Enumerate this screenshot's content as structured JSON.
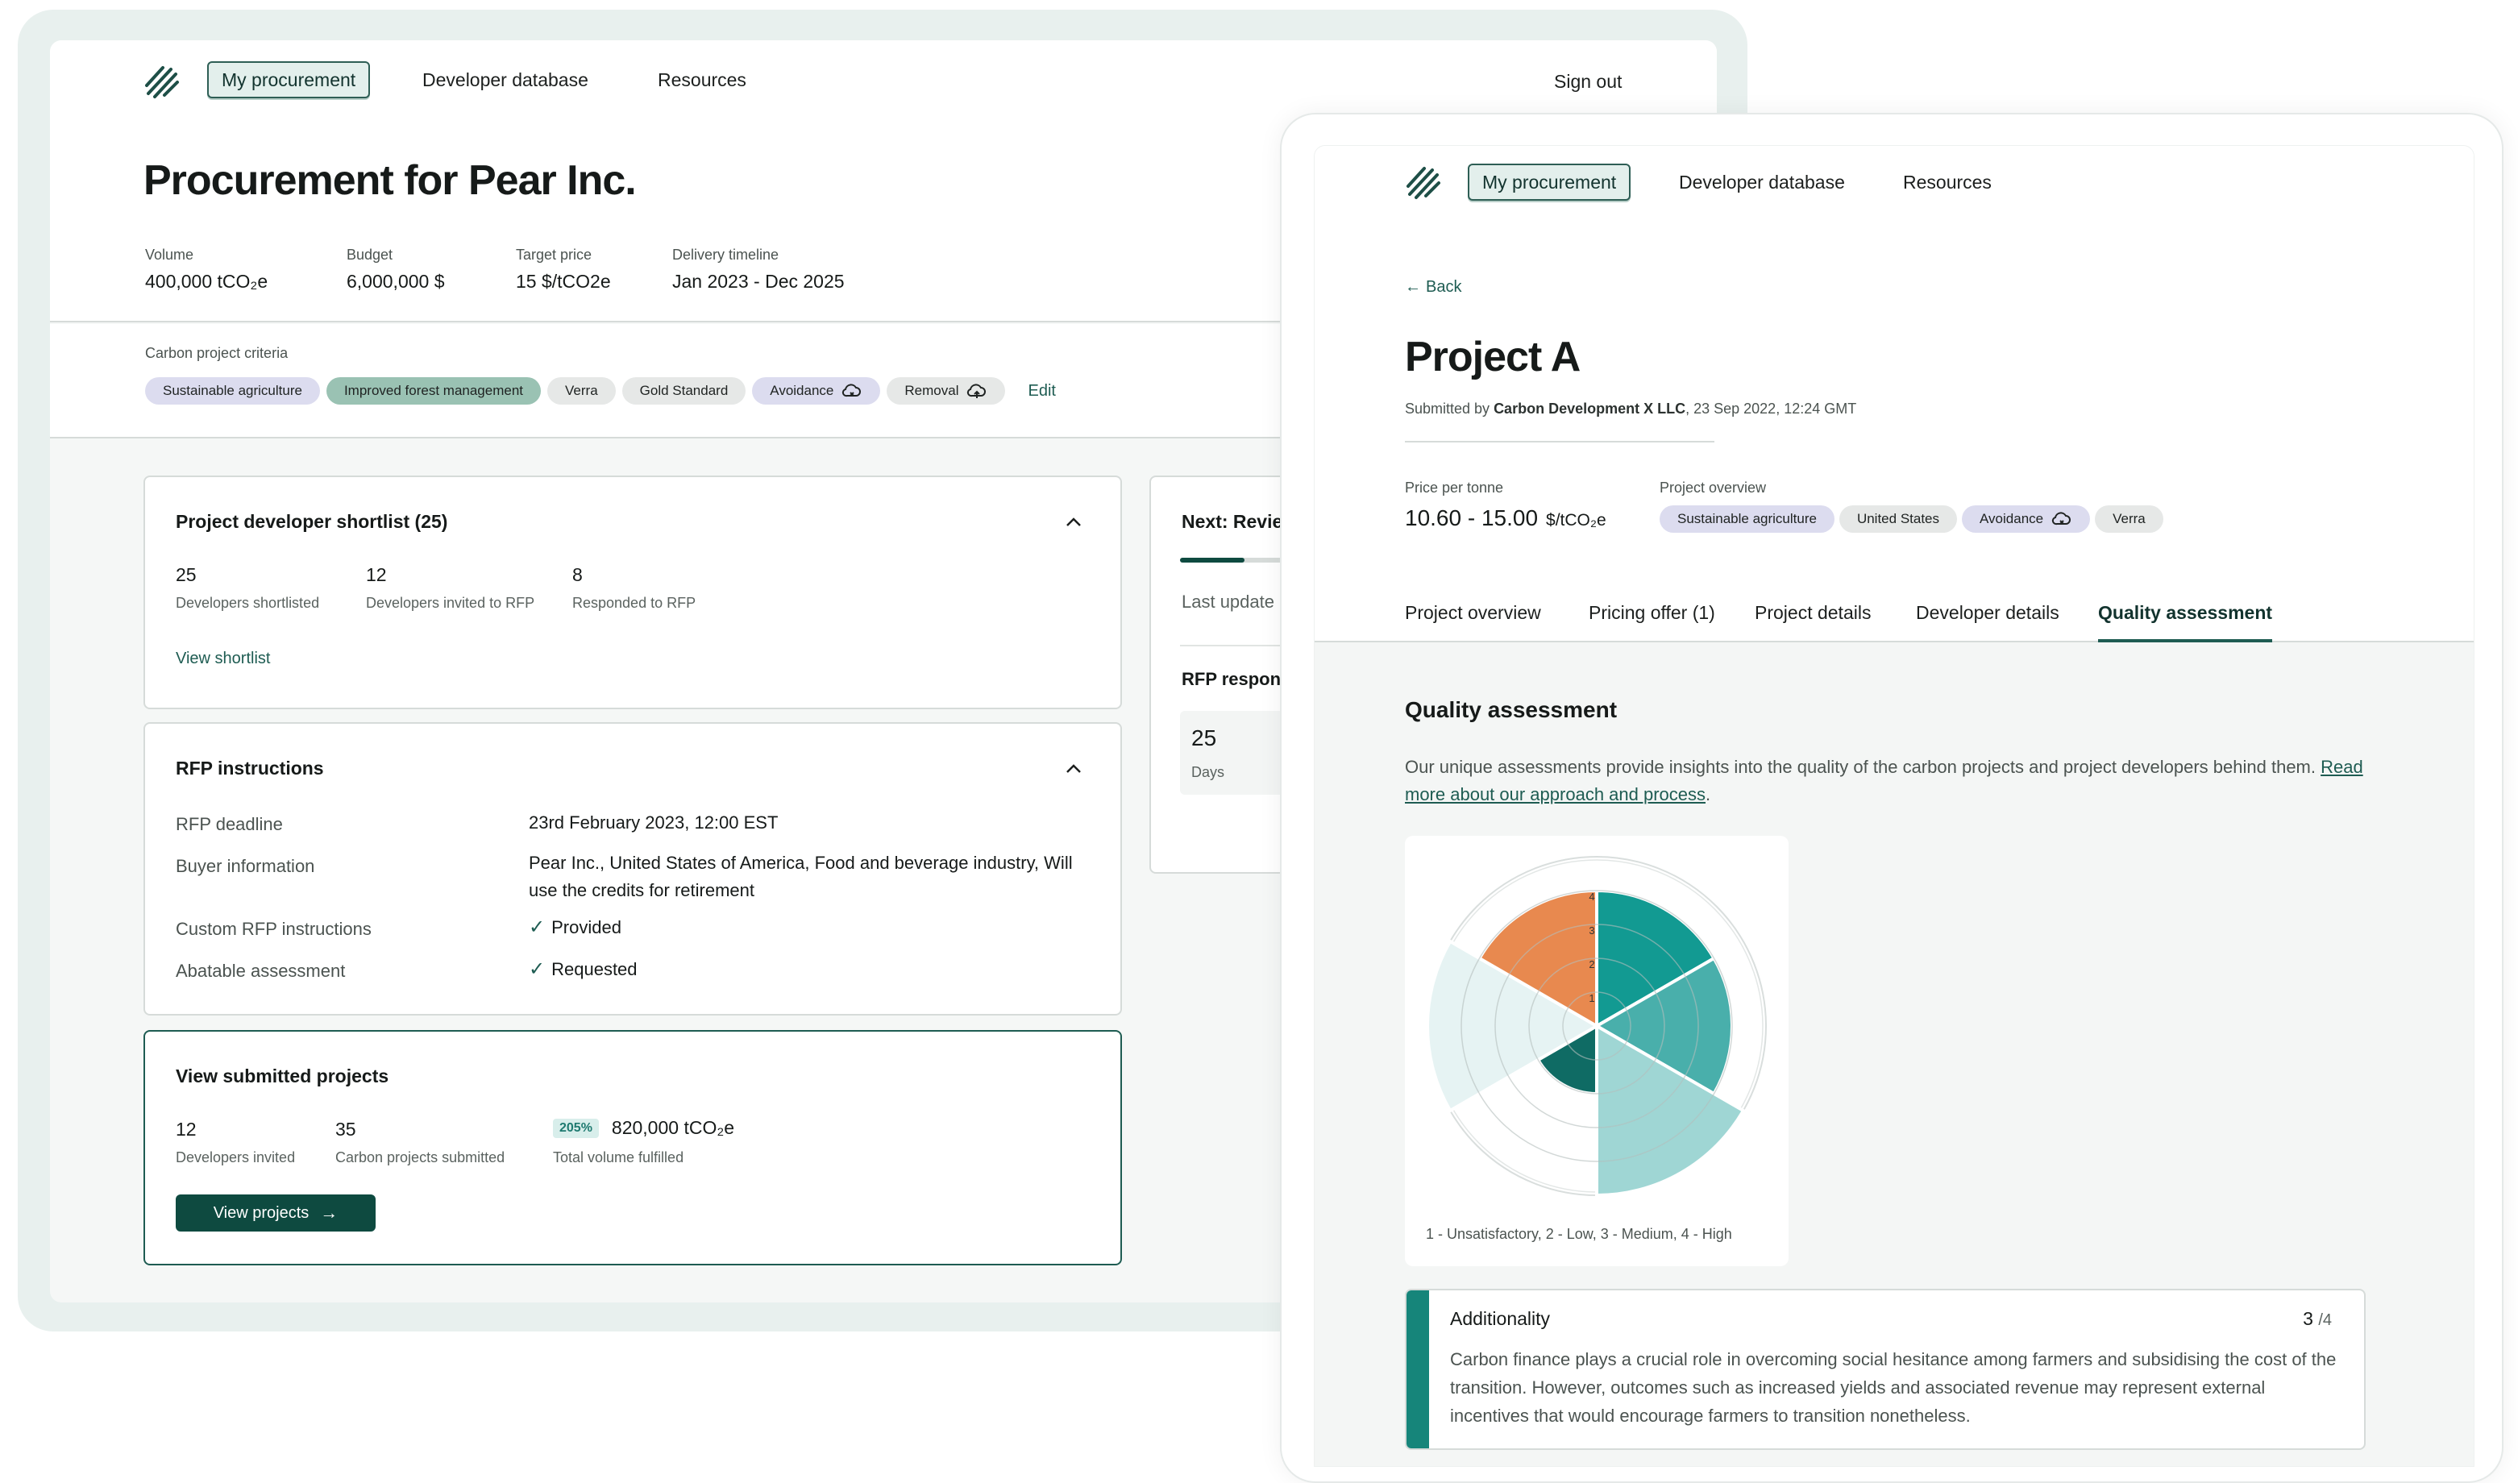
{
  "back": {
    "nav": {
      "active": "My procurement",
      "items": [
        "Developer database",
        "Resources"
      ],
      "sign_out": "Sign out"
    },
    "title": "Procurement for Pear Inc.",
    "meta": [
      {
        "label": "Volume",
        "value": "400,000 tCO₂e"
      },
      {
        "label": "Budget",
        "value": "6,000,000 $"
      },
      {
        "label": "Target price",
        "value": "15 $/tCO2e"
      },
      {
        "label": "Delivery timeline",
        "value": "Jan 2023 - Dec 2025"
      }
    ],
    "criteria": {
      "label": "Carbon project criteria",
      "chips": [
        "Sustainable agriculture",
        "Improved forest management",
        "Verra",
        "Gold Standard",
        "Avoidance",
        "Removal"
      ],
      "edit": "Edit"
    },
    "shortlist": {
      "title": "Project developer shortlist (25)",
      "stats": [
        {
          "num": "25",
          "label": "Developers shortlisted"
        },
        {
          "num": "12",
          "label": "Developers invited to RFP"
        },
        {
          "num": "8",
          "label": "Responded to RFP"
        }
      ],
      "link": "View shortlist"
    },
    "rfp": {
      "title": "RFP instructions",
      "rows": [
        {
          "label": "RFP deadline",
          "value": "23rd February 2023, 12:00 EST"
        },
        {
          "label": "Buyer information",
          "value": "Pear Inc., United States of America, Food and beverage industry, Will use the credits for retirement"
        },
        {
          "label": "Custom RFP instructions",
          "value": "Provided"
        },
        {
          "label": "Abatable assessment",
          "value": "Requested"
        }
      ]
    },
    "submitted": {
      "title": "View submitted projects",
      "stats": [
        {
          "num": "12",
          "label": "Developers invited"
        },
        {
          "num": "35",
          "label": "Carbon projects submitted"
        },
        {
          "num": "820,000 tCO₂e",
          "label": "Total volume fulfilled",
          "badge": "205%"
        }
      ],
      "button": "View projects"
    },
    "next": {
      "title": "Next: Revie",
      "last_update": "Last update",
      "rfp_resp": "RFP respon",
      "days_num": "25",
      "days_label": "Days",
      "progress_fraction": 0.5
    }
  },
  "front": {
    "nav": {
      "active": "My procurement",
      "items": [
        "Developer database",
        "Resources"
      ]
    },
    "back_link": "Back",
    "title": "Project A",
    "submitted_prefix": "Submitted by ",
    "submitted_by": "Carbon Development X LLC",
    "submitted_date": ", 23 Sep 2022, 12:24 GMT",
    "price_label": "Price per tonne",
    "price_value": "10.60 - 15.00",
    "price_unit": "$/tCO₂e",
    "overview_label": "Project overview",
    "overview_chips": [
      "Sustainable agriculture",
      "United States",
      "Avoidance",
      "Verra"
    ],
    "tabs": [
      "Project overview",
      "Pricing offer (1)",
      "Project details",
      "Developer details",
      "Quality assessment"
    ],
    "selected_tab": "Quality assessment",
    "qa": {
      "title": "Quality assessment",
      "text": "Our unique assessments provide insights into the quality of the carbon projects and project developers behind them. ",
      "link": "Read more about our approach and process",
      "after_link": ".",
      "legend": "1 - Unsatisfactory, 2 - Low, 3 - Medium, 4 - High"
    },
    "additionality": {
      "title": "Additionality",
      "score": "3",
      "max": "/4",
      "text": "Carbon finance plays a crucial role in overcoming social hesitance among farmers and subsidising the cost of the transition. However, outcomes such as increased yields and associated revenue may represent external incentives that would encourage farmers to transition nonetheless."
    }
  },
  "chart_data": {
    "type": "polar-area",
    "rmax": 4,
    "ticks": [
      "1",
      "2",
      "3",
      "4"
    ],
    "sectors": [
      {
        "value": 4,
        "color": "#129a92"
      },
      {
        "value": 4,
        "color": "#49afab"
      },
      {
        "value": 5,
        "color": "#9fd6d4"
      },
      {
        "value": 2,
        "color": "#0f6b64"
      },
      {
        "value": 5,
        "color": "#e6f3f3"
      },
      {
        "value": 4,
        "color": "#e8894f"
      }
    ]
  }
}
